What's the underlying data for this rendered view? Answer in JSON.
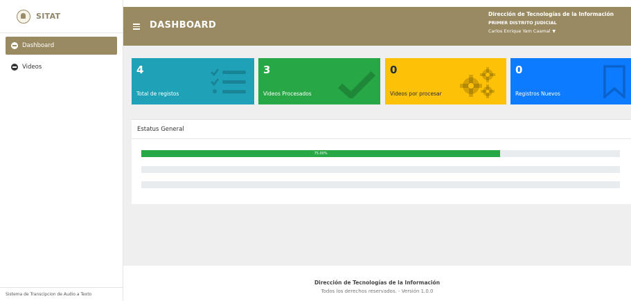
{
  "app": {
    "name": "SITAT"
  },
  "sidebar": {
    "items": [
      {
        "label": "Dashboard",
        "active": true,
        "icon": "dashboard-icon"
      },
      {
        "label": "Videos",
        "active": false,
        "icon": "videos-icon"
      }
    ],
    "footer": "Sistema de Transcipcion de Audio a Texto"
  },
  "header": {
    "title": "DASHBOARD",
    "org": "Dirección de Tecnologías de la Información",
    "district": "PRIMER DISTRITO JUDICIAL",
    "user": "Carlos Enrique Yam Caamal"
  },
  "cards": [
    {
      "value": "4",
      "label": "Total de registos",
      "color": "#1fa2b8",
      "icon": "list-check-icon"
    },
    {
      "value": "3",
      "label": "Videos Procesados",
      "color": "#27a745",
      "icon": "checkmark-icon"
    },
    {
      "value": "0",
      "label": "Videos por procesar",
      "color": "#fdc107",
      "icon": "gears-icon"
    },
    {
      "value": "0",
      "label": "Registros Nuevos",
      "color": "#0d7bff",
      "icon": "bookmark-icon"
    }
  ],
  "status": {
    "title": "Estatus General",
    "bars": [
      {
        "percent": 75,
        "label": "75.00%"
      },
      {
        "percent": 0,
        "label": ""
      },
      {
        "percent": 0,
        "label": ""
      }
    ]
  },
  "footer": {
    "line1": "Dirección de Tecnologías de la Información",
    "line2": "Todos los derechos reservados. - Versión 1.0.0"
  },
  "colors": {
    "accent": "#9a8a62",
    "success": "#28a745"
  }
}
